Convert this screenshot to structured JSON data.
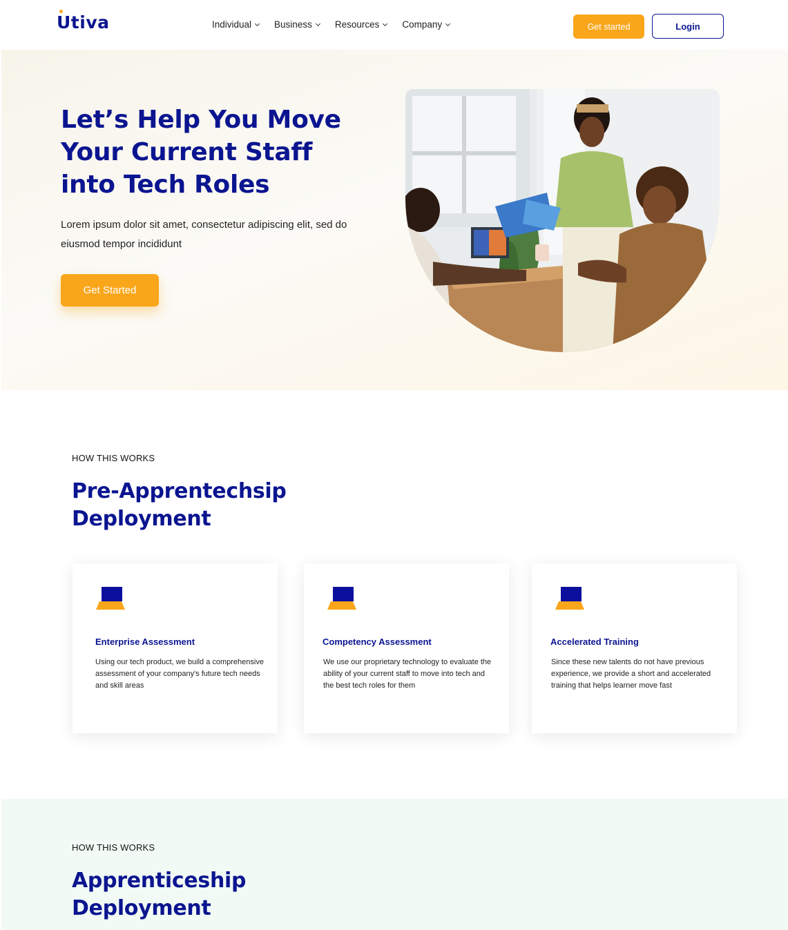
{
  "nav": {
    "logo": "Utiva",
    "links": [
      {
        "label": "Individual"
      },
      {
        "label": "Business"
      },
      {
        "label": "Resources"
      },
      {
        "label": "Company"
      }
    ],
    "get_started": "Get started",
    "login": "Login"
  },
  "hero": {
    "title": "Let’s Help You Move Your Current Staff into Tech Roles",
    "subtitle": "Lorem ipsum dolor sit amet, consectetur adipiscing elit, sed do eiusmod tempor incididunt",
    "cta": "Get Started"
  },
  "section1": {
    "eyebrow": "HOW THIS WORKS",
    "title": "Pre-Apprentechsip Deployment",
    "cards": [
      {
        "title": "Enterprise Assessment",
        "text": "Using our tech product, we build a comprehensive assessment of your company's future tech needs and skill areas",
        "icon": "laptop-icon"
      },
      {
        "title": "Competency Assessment",
        "text": "We use our proprietary technology to evaluate the ability of your current staff to move into tech and the best tech roles for them",
        "icon": "laptop-icon"
      },
      {
        "title": "Accelerated Training",
        "text": "Since these new talents do not have previous experience, we provide a short and accelerated training that helps learner move fast",
        "icon": "laptop-icon"
      }
    ]
  },
  "section2": {
    "eyebrow": "HOW THIS WORKS",
    "title": "Apprenticeship Deployment"
  },
  "colors": {
    "brand_blue": "#0b1590",
    "accent_orange": "#f9a61b",
    "section2_bg": "#f1faf5"
  }
}
